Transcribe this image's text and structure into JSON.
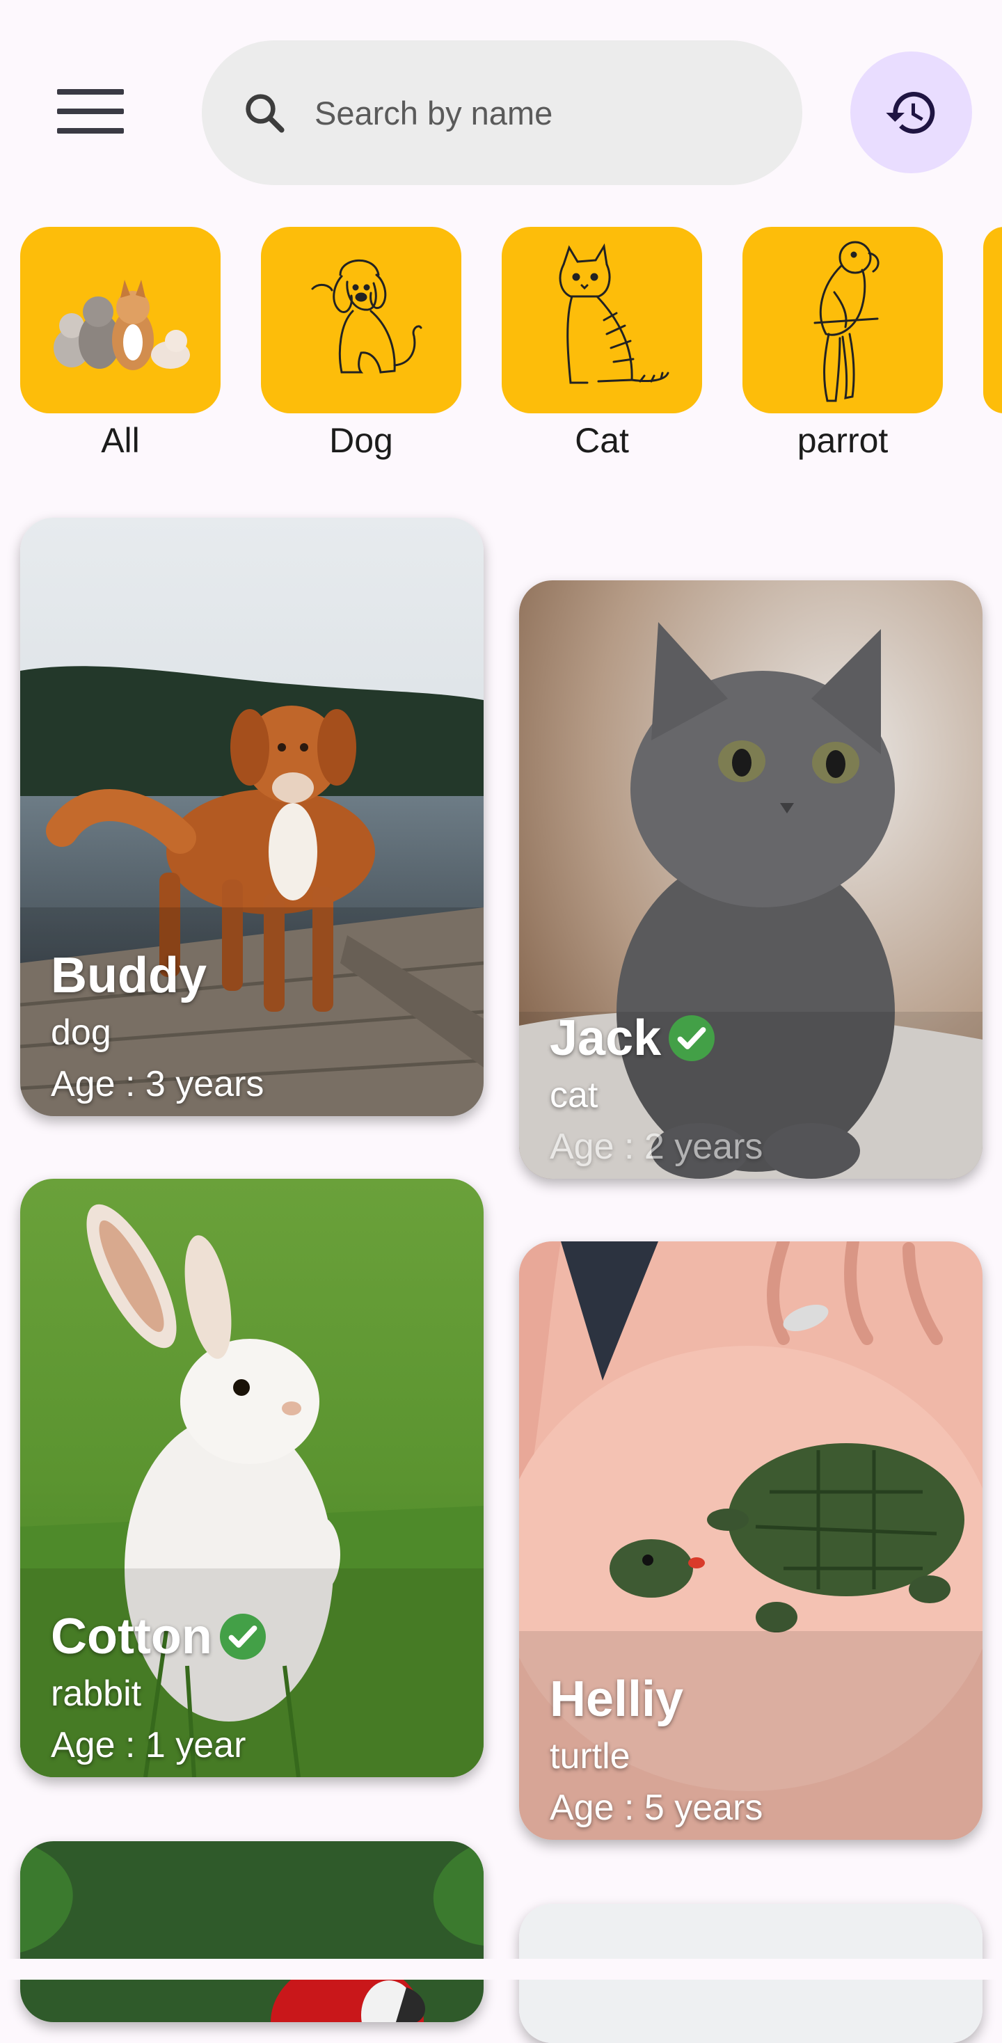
{
  "search": {
    "placeholder": "Search by name"
  },
  "icons": {
    "menu": "menu-icon",
    "search": "search-icon",
    "history": "history-icon",
    "verified": "verified-check-icon"
  },
  "colors": {
    "accent": "#fdbd0a",
    "history_bg": "#e9ddff",
    "verified": "#43a047"
  },
  "categories": [
    {
      "label": "All"
    },
    {
      "label": "Dog"
    },
    {
      "label": "Cat"
    },
    {
      "label": "parrot"
    }
  ],
  "pets": [
    {
      "name": "Buddy",
      "kind": "dog",
      "age": "Age : 3 years",
      "verified": false
    },
    {
      "name": "Jack",
      "kind": "cat",
      "age": "Age : 2 years",
      "verified": true
    },
    {
      "name": "Cotton",
      "kind": "rabbit",
      "age": "Age : 1 year",
      "verified": true
    },
    {
      "name": "Helliy",
      "kind": "turtle",
      "age": "Age : 5 years",
      "verified": false
    }
  ]
}
